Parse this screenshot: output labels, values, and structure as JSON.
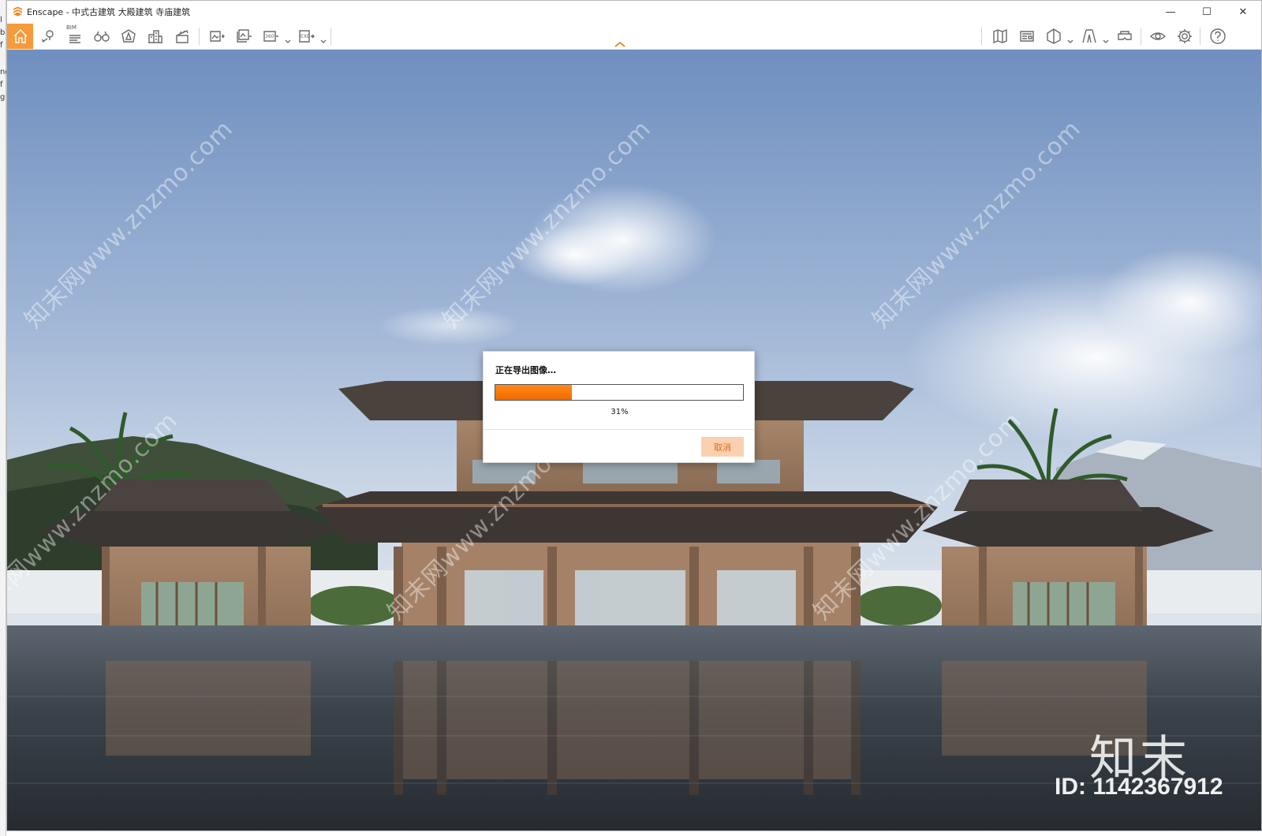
{
  "window": {
    "title": "Enscape - 中式古建筑 大殿建筑 寺庙建筑",
    "controls": {
      "minimize": "—",
      "maximize": "☐",
      "close": "✕"
    }
  },
  "background_window": {
    "fragments": [
      "l",
      "b",
      "f",
      "ng",
      "f",
      "g"
    ]
  },
  "toolbar": {
    "left_tools": [
      {
        "id": "home",
        "icon": "home-icon",
        "active": true
      },
      {
        "id": "sync",
        "icon": "location-icon"
      },
      {
        "id": "bim",
        "icon": "bim-icon",
        "label": "BIM"
      },
      {
        "id": "walk",
        "icon": "binoculars-icon"
      },
      {
        "id": "assets",
        "icon": "asset-library-icon"
      },
      {
        "id": "buildings",
        "icon": "buildings-icon"
      },
      {
        "id": "video",
        "icon": "clapperboard-icon"
      },
      {
        "id": "screenshot",
        "icon": "render-image-icon"
      },
      {
        "id": "batch",
        "icon": "batch-render-icon"
      },
      {
        "id": "pano",
        "icon": "panorama-icon",
        "label": "360°"
      },
      {
        "id": "exe",
        "icon": "export-exe-icon",
        "label": "EXE"
      }
    ],
    "right_tools": [
      {
        "id": "map",
        "icon": "map-icon"
      },
      {
        "id": "views",
        "icon": "view-management-icon"
      },
      {
        "id": "box",
        "icon": "cube-icon"
      },
      {
        "id": "path",
        "icon": "path-icon"
      },
      {
        "id": "vr",
        "icon": "vr-headset-icon"
      },
      {
        "id": "visibility",
        "icon": "eye-icon"
      },
      {
        "id": "settings",
        "icon": "gear-icon"
      },
      {
        "id": "help",
        "icon": "help-icon"
      }
    ],
    "accent_color": "#f59b3b"
  },
  "viewport": {
    "watermark_text": "知末网www.znzmo.com",
    "brand_watermark": "知末",
    "id_watermark": "ID: 1142367912"
  },
  "export_dialog": {
    "title": "正在导出图像…",
    "progress": 0.31,
    "progress_label": "31%",
    "cancel_label": "取消",
    "progress_color": "#f57a0b"
  }
}
